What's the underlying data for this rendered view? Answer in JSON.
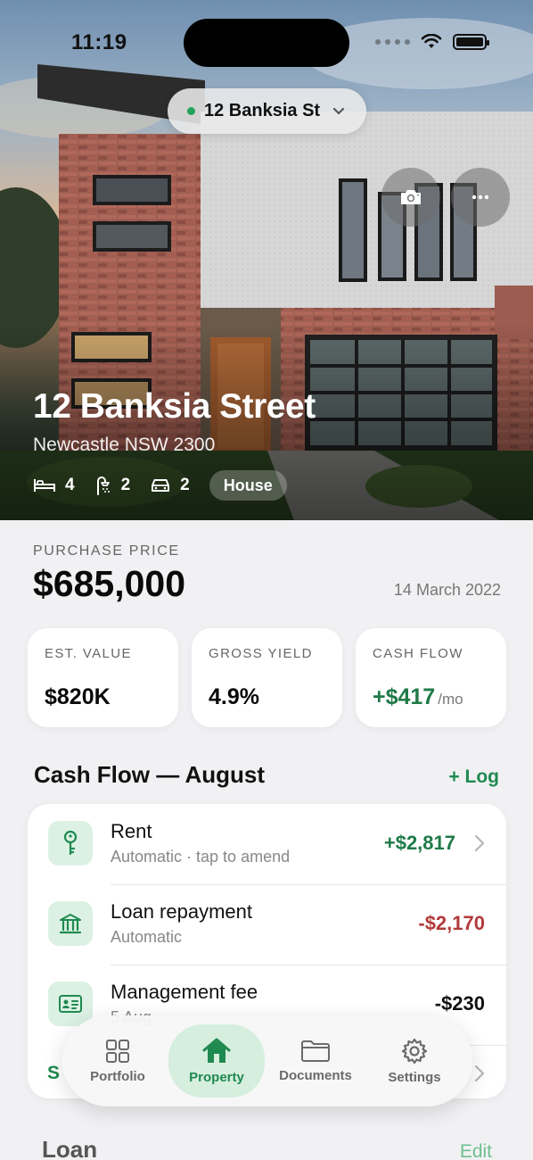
{
  "status_bar": {
    "time": "11:19"
  },
  "property_picker": {
    "label": "12 Banksia St"
  },
  "hero": {
    "title": "12 Banksia Street",
    "subtitle": "Newcastle NSW 2300",
    "features": {
      "bedrooms": "4",
      "bathrooms": "2",
      "car_spaces": "2",
      "type": "House"
    }
  },
  "purchase": {
    "label": "PURCHASE PRICE",
    "value": "$685,000",
    "date": "14 March 2022"
  },
  "stats": [
    {
      "label": "EST. VALUE",
      "value": "$820K"
    },
    {
      "label": "GROSS YIELD",
      "value": "4.9%"
    },
    {
      "label": "CASH FLOW",
      "value": "+$417",
      "unit": "/mo"
    }
  ],
  "cash_flow": {
    "title": "Cash Flow — August",
    "action": "+ Log",
    "items": [
      {
        "title": "Rent",
        "subtitle": "Automatic · tap to amend",
        "amount": "+$2,817",
        "icon": "key-icon"
      },
      {
        "title": "Loan repayment",
        "subtitle": "Automatic",
        "amount": "-$2,170",
        "icon": "bank-icon"
      },
      {
        "title": "Management fee",
        "subtitle": "5 Aug",
        "amount": "-$230",
        "icon": "id-card-icon"
      }
    ],
    "partial_row_letter": "S"
  },
  "tabs": [
    {
      "label": "Portfolio",
      "icon": "grid-icon"
    },
    {
      "label": "Property",
      "icon": "house-icon",
      "active": true
    },
    {
      "label": "Documents",
      "icon": "folder-icon"
    },
    {
      "label": "Settings",
      "icon": "gear-icon"
    }
  ],
  "loan": {
    "title": "Loan",
    "action": "Edit"
  },
  "colors": {
    "accent": "#1f8a50",
    "positive": "#1f7a48",
    "negative": "#b23a3a",
    "icon_bg": "#dcf1e4"
  }
}
